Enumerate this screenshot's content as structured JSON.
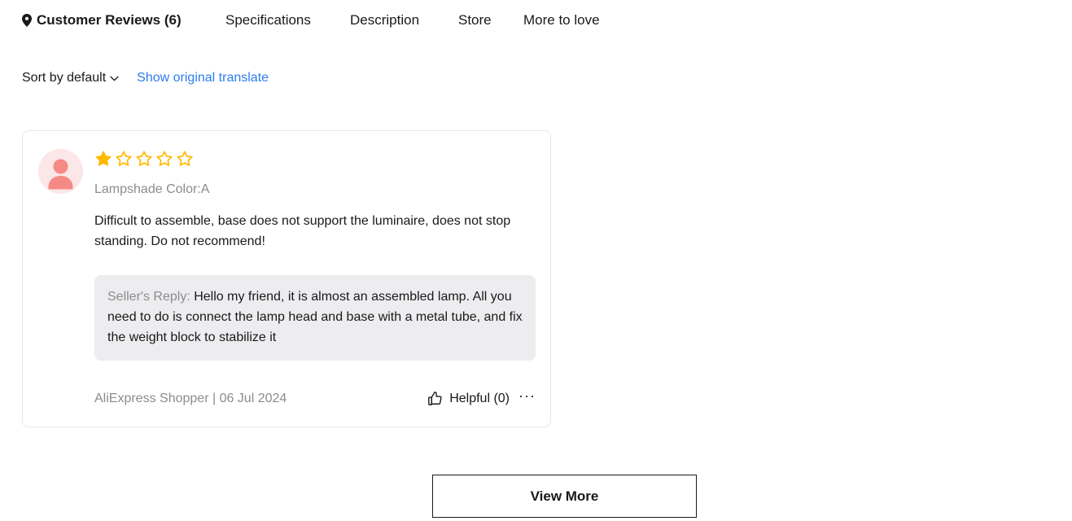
{
  "nav": {
    "active_icon": "location-pin-icon",
    "items": [
      {
        "label": "Customer Reviews (6)",
        "active": true
      },
      {
        "label": "Specifications",
        "active": false
      },
      {
        "label": "Description",
        "active": false
      },
      {
        "label": "Store",
        "active": false
      },
      {
        "label": "More to love",
        "active": false
      }
    ]
  },
  "controls": {
    "sort_label": "Sort by default",
    "sort_icon": "chevron-down-icon",
    "translate_link": "Show original translate",
    "link_color": "#2e7dee"
  },
  "review": {
    "avatar_icon": "user-avatar-icon",
    "rating": 1,
    "max_rating": 5,
    "star_color": "#ffba00",
    "sku": "Lampshade Color:A",
    "body": "Difficult to assemble, base does not support the luminaire, does not stop standing. Do not recommend!",
    "seller_reply_label": "Seller's Reply:",
    "seller_reply_body": "Hello my friend, it is almost an assembled lamp. All you need to do is connect the lamp head and base with a metal tube, and fix the weight block to stabilize it",
    "author_meta": "AliExpress Shopper | 06 Jul 2024",
    "helpful_icon": "thumbs-up-icon",
    "helpful_label": "Helpful (0)",
    "more_icon": "more-horizontal-icon",
    "more_glyph": "···"
  },
  "footer": {
    "view_more_label": "View More"
  }
}
